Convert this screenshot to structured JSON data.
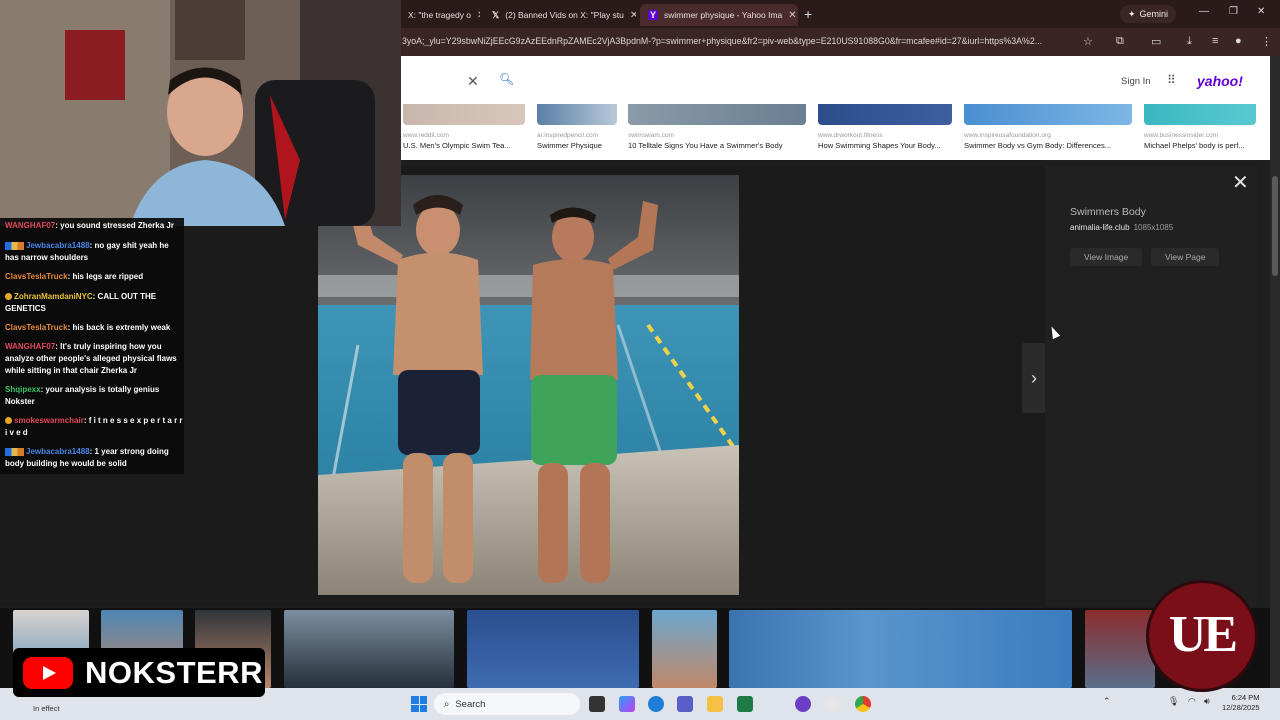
{
  "browser": {
    "tabs": [
      {
        "label": "X: \"the tragedy o",
        "icon": "x-logo-icon"
      },
      {
        "label": "(2) Banned Vids on X: \"Play stu",
        "icon": "x-logo-icon"
      },
      {
        "label": "swimmer physique - Yahoo Ima",
        "icon": "yahoo-icon",
        "active": true
      }
    ],
    "new_tab": "+",
    "gemini_label": "Gemini",
    "url": "3yoA;_ylu=Y29sbwNiZjEEcG9zAzEEdnRpZAMEc2VjA3BpdnM-?p=swimmer+physique&fr2=piv-web&type=E210US91088G0&fr=mcafee#id=27&iurl=https%3A%2..."
  },
  "yahoo": {
    "sign_in": "Sign In",
    "logo": "yahoo!"
  },
  "related": [
    {
      "source": "www.reddit.com",
      "caption": "U.S. Men's Olympic Swim Tea..."
    },
    {
      "source": "ar.inspiredpencil.com",
      "caption": "Swimmer Physique"
    },
    {
      "source": "swimswam.com",
      "caption": "10 Telltale Signs You Have a Swimmer's Body"
    },
    {
      "source": "www.drworkout.fitness",
      "caption": "How Swimming Shapes Your Body..."
    },
    {
      "source": "www.inspireusafoundation.org",
      "caption": "Swimmer Body vs Gym Body: Differences..."
    },
    {
      "source": "www.businessinsider.com",
      "caption": "Michael Phelps' body is perf..."
    }
  ],
  "lightbox": {
    "title": "Swimmers Body",
    "domain": "animalia-life.club",
    "dimensions": "1085x1085",
    "view_image": "View Image",
    "view_page": "View Page",
    "close": "✕",
    "next": "›"
  },
  "chat": [
    {
      "user": "WANGHAF07",
      "color": "#e0475a",
      "text": ": you sound stressed Zherka Jr",
      "badge": "none"
    },
    {
      "user": "Jewbacabra1488",
      "color": "#4a86e8",
      "text": ": no gay shit yeah he has narrow shoulders",
      "badge": "multi"
    },
    {
      "user": "ClavsTeslaTruck",
      "color": "#e8893a",
      "text": ": his legs are ripped",
      "badge": "none"
    },
    {
      "user": "ZohranMamdaniNYC",
      "color": "#e8c13a",
      "text": ": CALL OUT THE GENETICS",
      "badge": "dot"
    },
    {
      "user": "ClavsTeslaTruck",
      "color": "#e8893a",
      "text": ": his back is extremly weak",
      "badge": "none"
    },
    {
      "user": "WANGHAF07",
      "color": "#e0475a",
      "text": ": It's truly inspiring how you analyze other people's alleged physical flaws while sitting in that chair Zherka Jr",
      "badge": "none"
    },
    {
      "user": "Shqipexx",
      "color": "#3ac46a",
      "text": ": your analysis is totally genius Nokster",
      "badge": "none"
    },
    {
      "user": "smokeswarmchair",
      "color": "#e0475a",
      "text": ": f i t n e s s e x p e r t a r r i v e d",
      "badge": "dot"
    },
    {
      "user": "Jewbacabra1488",
      "color": "#4a86e8",
      "text": ": 1 year strong doing body building he would be solid",
      "badge": "multi"
    }
  ],
  "branding": {
    "channel": "NOKSTERR",
    "badge_text": "UE"
  },
  "taskbar": {
    "search_placeholder": "Search",
    "time": "6:24 PM",
    "date": "12/28/2025",
    "in_effect": "In effect"
  }
}
